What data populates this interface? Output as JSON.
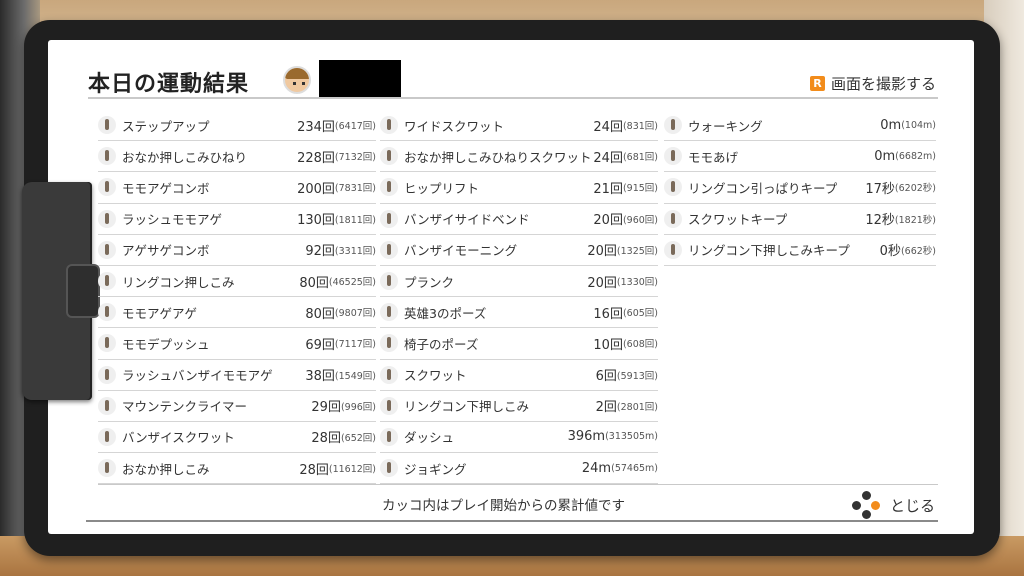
{
  "header": {
    "title": "本日の運動結果",
    "screenshot_badge": "R",
    "screenshot_label": "画面を撮影する"
  },
  "columns": [
    [
      {
        "name": "ステップアップ",
        "value": "234回",
        "total": "(6417回)"
      },
      {
        "name": "おなか押しこみひねり",
        "value": "228回",
        "total": "(7132回)"
      },
      {
        "name": "モモアゲコンボ",
        "value": "200回",
        "total": "(7831回)"
      },
      {
        "name": "ラッシュモモアゲ",
        "value": "130回",
        "total": "(1811回)"
      },
      {
        "name": "アゲサゲコンボ",
        "value": "92回",
        "total": "(3311回)"
      },
      {
        "name": "リングコン押しこみ",
        "value": "80回",
        "total": "(46525回)"
      },
      {
        "name": "モモアゲアゲ",
        "value": "80回",
        "total": "(9807回)"
      },
      {
        "name": "モモデプッシュ",
        "value": "69回",
        "total": "(7117回)"
      },
      {
        "name": "ラッシュバンザイモモアゲ",
        "value": "38回",
        "total": "(1549回)"
      },
      {
        "name": "マウンテンクライマー",
        "value": "29回",
        "total": "(996回)"
      },
      {
        "name": "バンザイスクワット",
        "value": "28回",
        "total": "(652回)"
      },
      {
        "name": "おなか押しこみ",
        "value": "28回",
        "total": "(11612回)"
      }
    ],
    [
      {
        "name": "ワイドスクワット",
        "value": "24回",
        "total": "(831回)"
      },
      {
        "name": "おなか押しこみひねりスクワット",
        "value": "24回",
        "total": "(681回)"
      },
      {
        "name": "ヒップリフト",
        "value": "21回",
        "total": "(915回)"
      },
      {
        "name": "バンザイサイドベンド",
        "value": "20回",
        "total": "(960回)"
      },
      {
        "name": "バンザイモーニング",
        "value": "20回",
        "total": "(1325回)"
      },
      {
        "name": "プランク",
        "value": "20回",
        "total": "(1330回)"
      },
      {
        "name": "英雄3のポーズ",
        "value": "16回",
        "total": "(605回)"
      },
      {
        "name": "椅子のポーズ",
        "value": "10回",
        "total": "(608回)"
      },
      {
        "name": "スクワット",
        "value": "6回",
        "total": "(5913回)"
      },
      {
        "name": "リングコン下押しこみ",
        "value": "2回",
        "total": "(2801回)"
      },
      {
        "name": "ダッシュ",
        "value": "396m",
        "total": "(313505m)"
      },
      {
        "name": "ジョギング",
        "value": "24m",
        "total": "(57465m)"
      }
    ],
    [
      {
        "name": "ウォーキング",
        "value": "0m",
        "total": "(104m)"
      },
      {
        "name": "モモあげ",
        "value": "0m",
        "total": "(6682m)"
      },
      {
        "name": "リングコン引っぱりキープ",
        "value": "17秒",
        "total": "(6202秒)"
      },
      {
        "name": "スクワットキープ",
        "value": "12秒",
        "total": "(1821秒)"
      },
      {
        "name": "リングコン下押しこみキープ",
        "value": "0秒",
        "total": "(662秒)"
      }
    ]
  ],
  "footer": {
    "note": "カッコ内はプレイ開始からの累計値です",
    "close_label": "とじる"
  },
  "colors": {
    "accent": "#f28c1b",
    "board": "#1f1f1f",
    "paper": "#ffffff"
  }
}
